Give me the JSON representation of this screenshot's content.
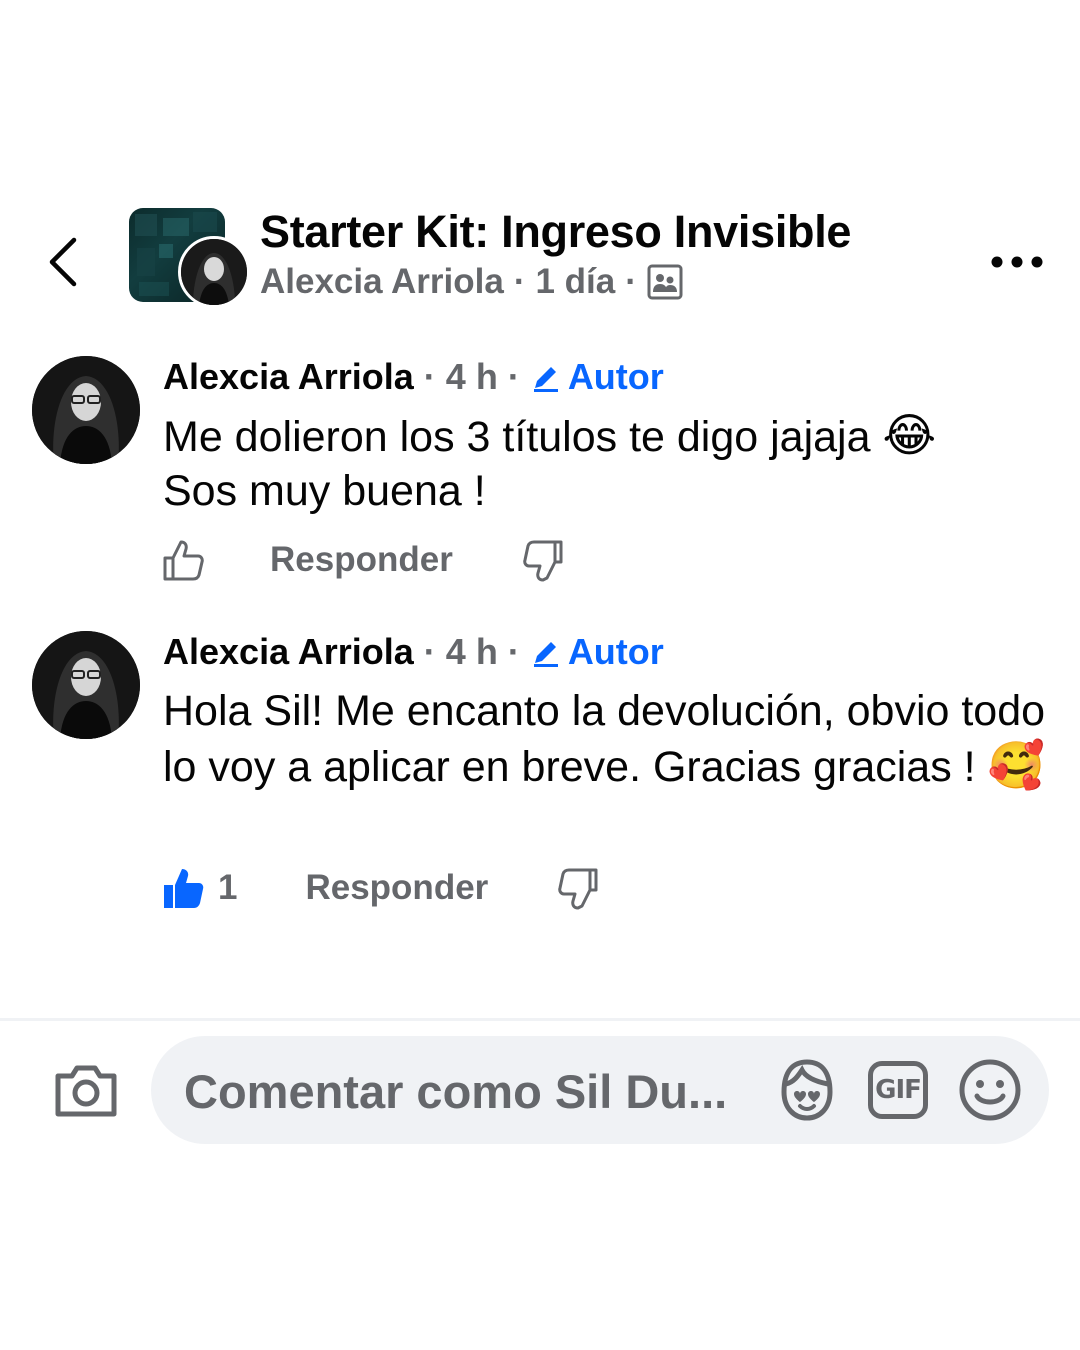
{
  "header": {
    "title": "Starter Kit: Ingreso Invisible",
    "author": "Alexcia Arriola",
    "sep1": "·",
    "time": "1 día",
    "sep2": "·",
    "privacy_icon": "group-members-icon"
  },
  "comments": [
    {
      "author": "Alexcia Arriola",
      "dot1": "·",
      "time": "4 h",
      "dot2": "·",
      "badge": "Autor",
      "line1": "Me dolieron los 3 títulos te digo jajaja ",
      "emoji1": "😂",
      "line2": "Sos muy buena !",
      "reply_label": "Responder"
    },
    {
      "author": "Alexcia Arriola",
      "dot1": "·",
      "time": "4 h",
      "dot2": "·",
      "badge": "Autor",
      "text": "Hola Sil! Me encanto la devolución, obvio todo lo voy a aplicar en breve. Gracias gracias ! ",
      "emoji": "🥰",
      "like_count": "1",
      "reply_label": "Responder"
    }
  ],
  "composer": {
    "placeholder": "Comentar como Sil Du...",
    "gif_label": "GIF",
    "icons": [
      "camera-icon",
      "avatar-sticker-icon",
      "gif-icon",
      "emoji-icon"
    ]
  },
  "colors": {
    "accent": "#0866ff",
    "secondary_text": "#65676b",
    "composer_bg": "#f0f2f5"
  }
}
